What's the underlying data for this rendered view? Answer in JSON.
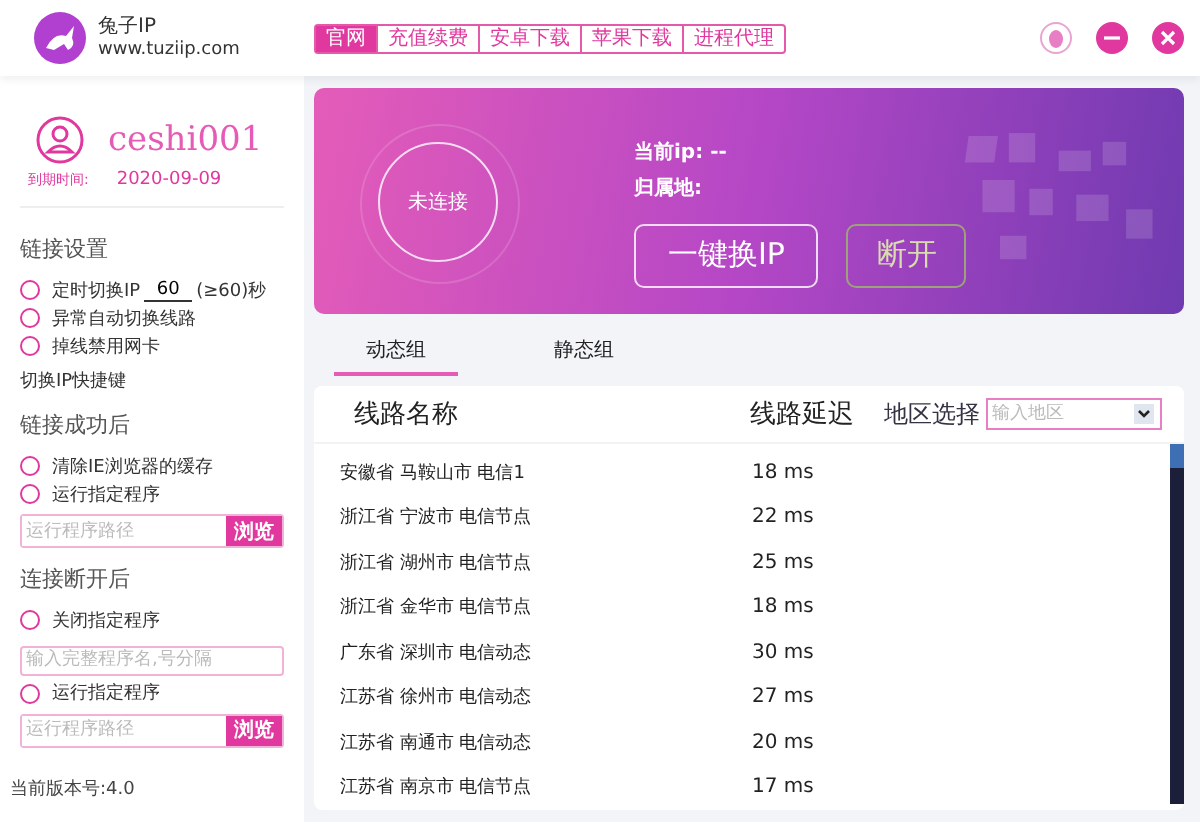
{
  "app": {
    "name": "兔子IP",
    "url": "www.tuziip.com"
  },
  "nav_tabs": [
    {
      "label": "官网",
      "selected": true
    },
    {
      "label": "充值续费",
      "selected": false
    },
    {
      "label": "安卓下载",
      "selected": false
    },
    {
      "label": "苹果下载",
      "selected": false
    },
    {
      "label": "进程代理",
      "selected": false
    }
  ],
  "user": {
    "name": "ceshi001",
    "expiry_label": "到期时间:",
    "expiry_date": "2020-09-09"
  },
  "settings_sections": [
    {
      "title": "链接设置",
      "items": [
        {
          "kind": "radio",
          "label": "定时切换IP",
          "value": "60",
          "suffix": "(≥60)秒",
          "checked": false
        },
        {
          "kind": "radio",
          "label": "异常自动切换线路",
          "checked": false
        },
        {
          "kind": "radio",
          "label": "掉线禁用网卡",
          "checked": false
        },
        {
          "kind": "text",
          "label": "切换IP快捷键"
        }
      ]
    },
    {
      "title": "链接成功后",
      "items": [
        {
          "kind": "radio",
          "label": "清除IE浏览器的缓存",
          "checked": false
        },
        {
          "kind": "radio",
          "label": "运行指定程序",
          "checked": false
        },
        {
          "kind": "path",
          "placeholder": "运行程序路径",
          "button": "浏览"
        }
      ]
    },
    {
      "title": "连接断开后",
      "items": [
        {
          "kind": "radio",
          "label": "关闭指定程序",
          "checked": false
        },
        {
          "kind": "input",
          "placeholder": "输入完整程序名,号分隔"
        },
        {
          "kind": "radio",
          "label": "运行指定程序",
          "checked": false
        },
        {
          "kind": "path",
          "placeholder": "运行程序路径",
          "button": "浏览"
        }
      ]
    }
  ],
  "version": "当前版本号:4.0",
  "status": {
    "state": "未连接",
    "current_ip": "当前ip: --",
    "location": "归属地:"
  },
  "buttons": [
    {
      "label": "一键换IP",
      "disabled": false
    },
    {
      "label": "断开",
      "disabled": true
    }
  ],
  "groups": [
    {
      "label": "动态组",
      "selected": true
    },
    {
      "label": "静态组",
      "selected": false
    }
  ],
  "table": {
    "columns": [
      "线路名称",
      "线路延迟"
    ],
    "region_label": "地区选择",
    "region_placeholder": "输入地区",
    "rows": [
      {
        "name": "安徽省 马鞍山市 电信1",
        "latency": "18 ms"
      },
      {
        "name": "浙江省 宁波市 电信节点",
        "latency": "22 ms"
      },
      {
        "name": "浙江省 湖州市 电信节点",
        "latency": "25 ms"
      },
      {
        "name": "浙江省 金华市 电信节点",
        "latency": "18 ms"
      },
      {
        "name": "广东省 深圳市 电信动态",
        "latency": "30 ms"
      },
      {
        "name": "江苏省 徐州市 电信动态",
        "latency": "27 ms"
      },
      {
        "name": "江苏省 南通市 电信动态",
        "latency": "20 ms"
      },
      {
        "name": "江苏省 南京市 电信节点",
        "latency": "17 ms"
      }
    ]
  }
}
